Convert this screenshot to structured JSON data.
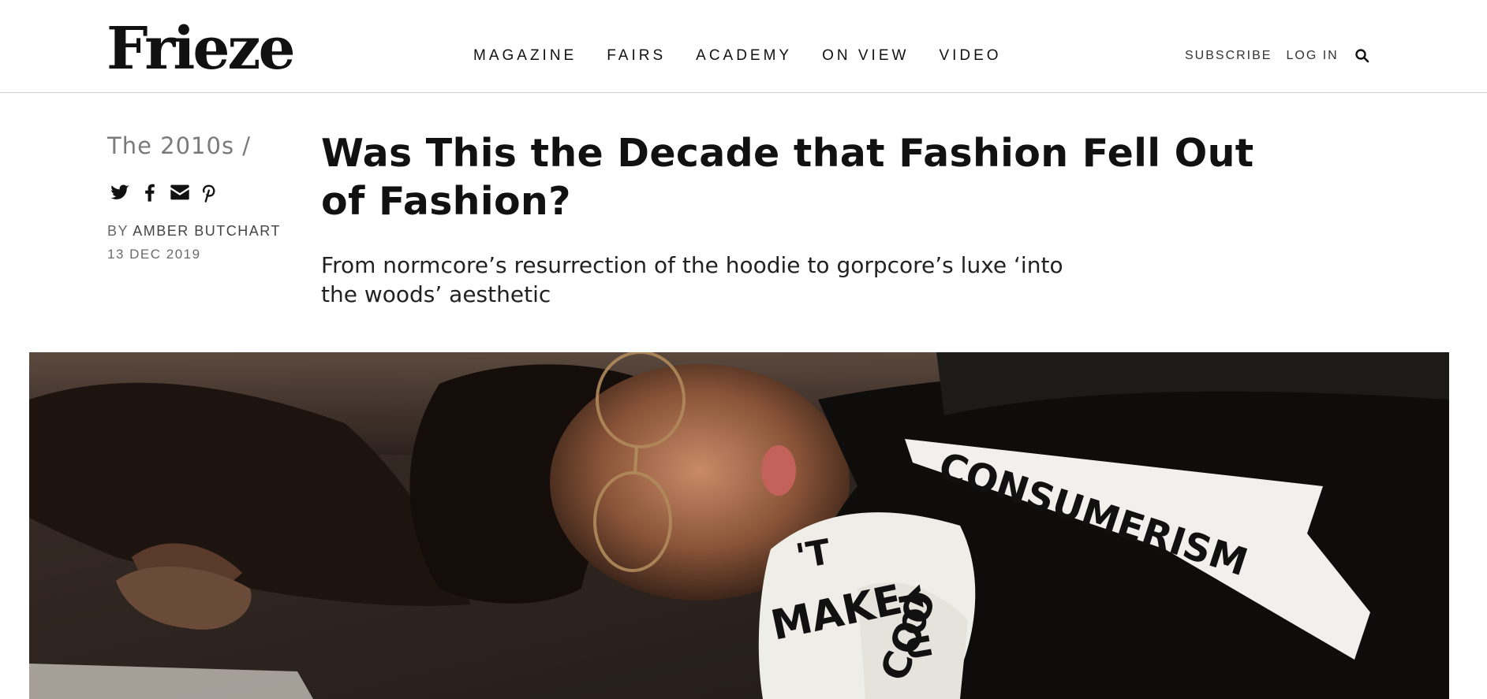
{
  "header": {
    "logo": "Frieze",
    "nav": [
      "MAGAZINE",
      "FAIRS",
      "ACADEMY",
      "ON VIEW",
      "VIDEO"
    ],
    "subscribe": "SUBSCRIBE",
    "login": "LOG IN",
    "search_icon": "search-icon"
  },
  "article": {
    "section": "The 2010s /",
    "share_icons": [
      "twitter-icon",
      "facebook-icon",
      "email-icon",
      "pinterest-icon"
    ],
    "by_prefix": "BY",
    "author": "AMBER BUTCHART",
    "date": "13 DEC 2019",
    "title": "Was This the Decade that Fashion Fell Out of Fashion?",
    "deck": "From normcore’s resurrection of the hoodie to gorpcore’s luxe ‘into the woods’ aesthetic"
  },
  "hero": {
    "fabric_text": "CONSUMERISM",
    "fabric_text_2": "MAKE",
    "fabric_text_3": "'T",
    "fabric_text_4": "YOU",
    "fabric_text_5": "COO"
  }
}
